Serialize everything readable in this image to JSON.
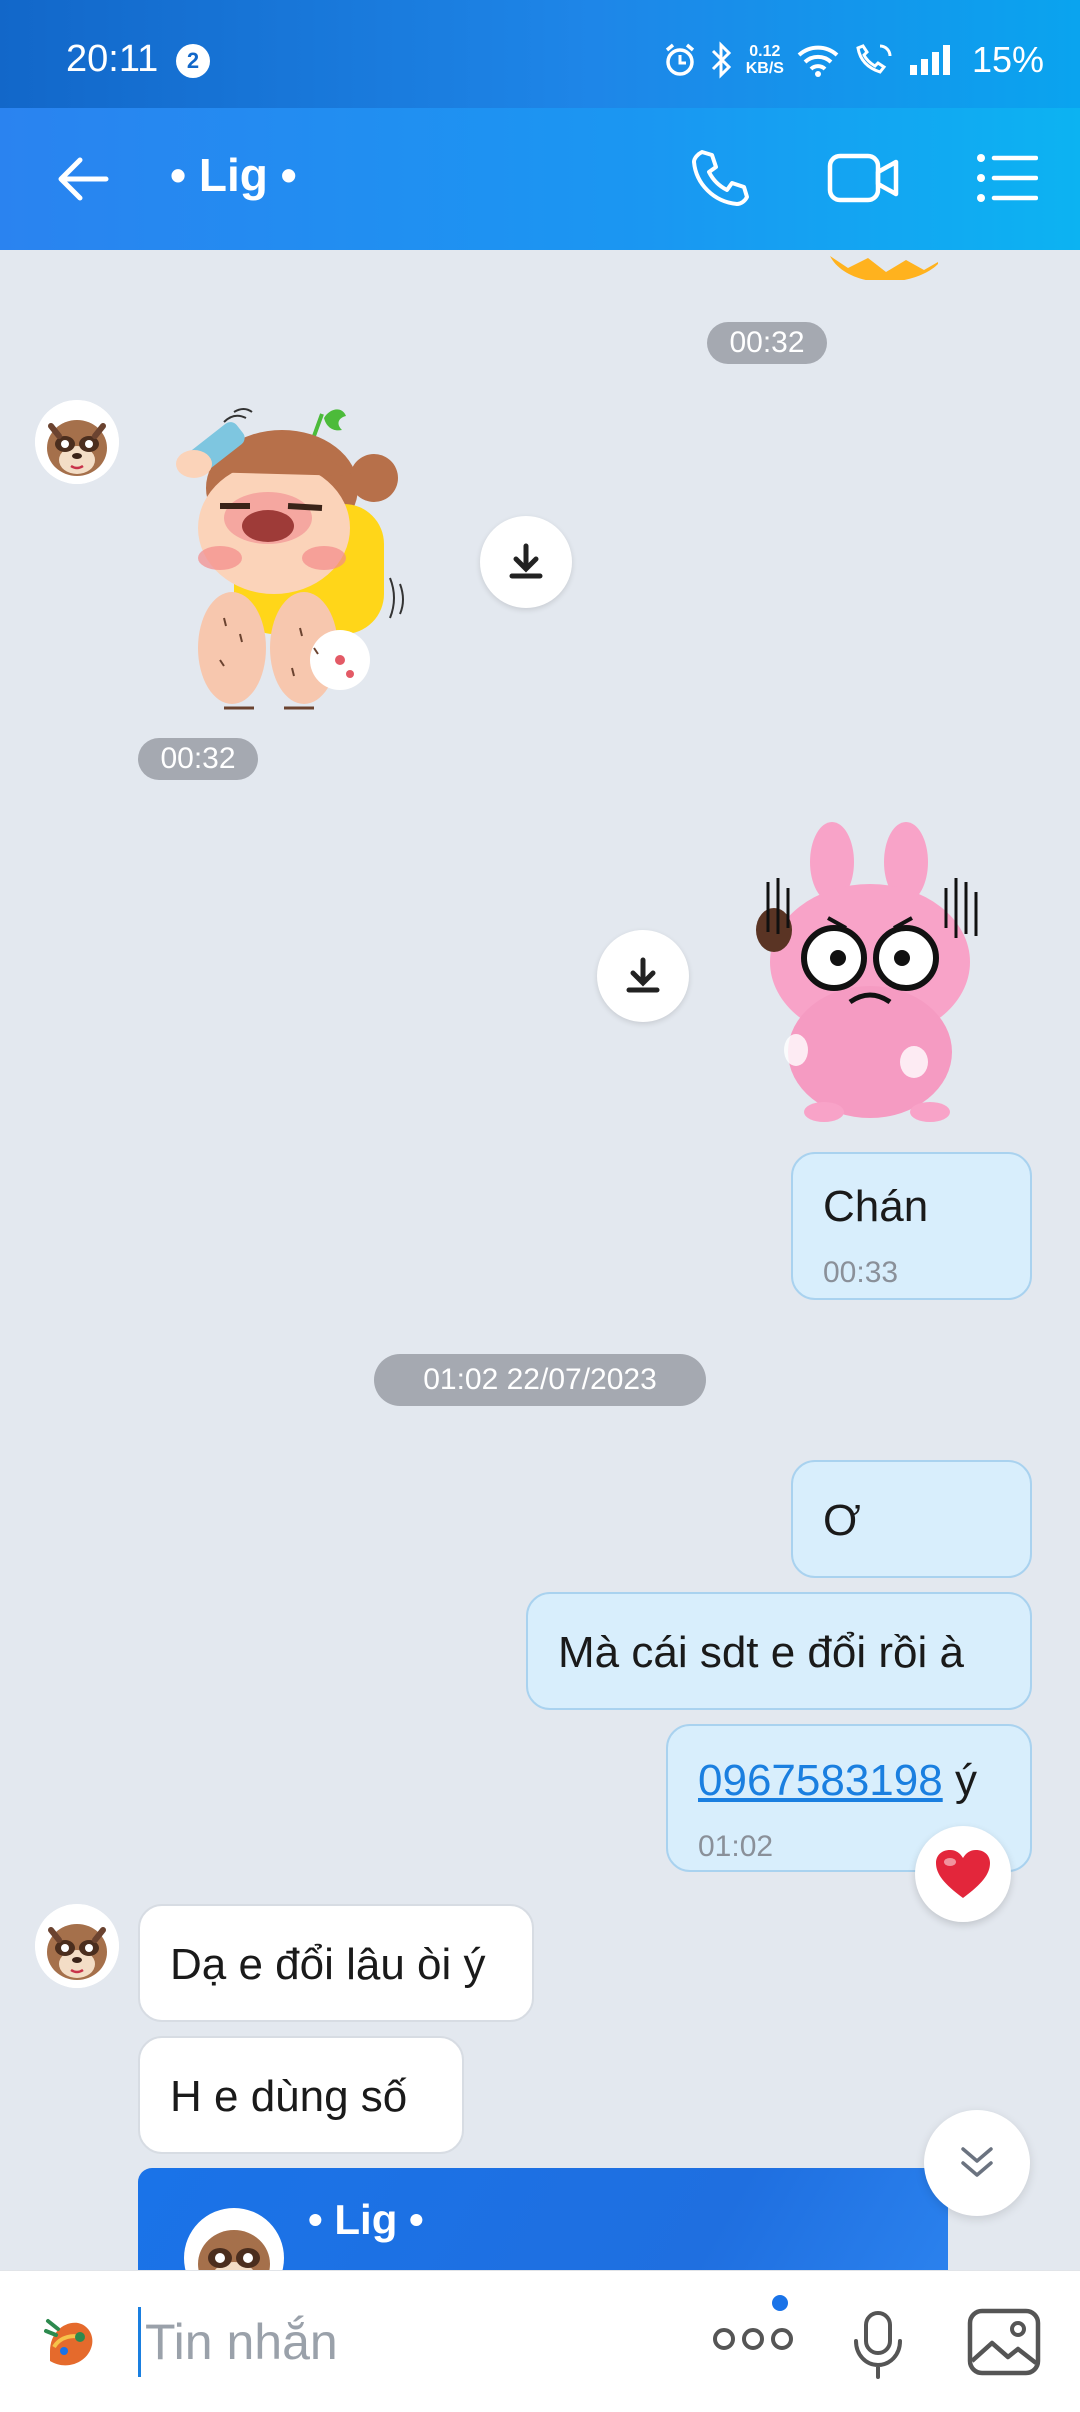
{
  "status_bar": {
    "time": "20:11",
    "notification_count": "2",
    "net_speed_value": "0.12",
    "net_speed_unit": "KB/S",
    "battery": "15%"
  },
  "header": {
    "title": "• Lig •"
  },
  "messages": {
    "time_sticker_sent": "00:32",
    "time_sticker_received": "00:32",
    "chan_text": "Chán",
    "chan_time": "00:33",
    "date_separator": "01:02 22/07/2023",
    "o_text": "Ơ",
    "ma_cai_text": "Mà cái sdt e đổi rồi à",
    "phone_number": "0967583198",
    "phone_suffix": " ý",
    "phone_time": "01:02",
    "reply1": "Dạ e đổi lâu òi ý",
    "reply2": "H e dùng số",
    "contact_card_name": "• Lig •"
  },
  "input_bar": {
    "placeholder": "Tin nhắn"
  },
  "colors": {
    "header_start": "#2a83f0",
    "header_end": "#0cb3f2",
    "my_bubble": "#d8eefc",
    "their_bubble": "#ffffff",
    "background": "#e3e8ef",
    "accent": "#1a73e8"
  },
  "icons": {
    "back": "arrow-left-icon",
    "call": "phone-icon",
    "video": "video-camera-icon",
    "menu": "list-menu-icon",
    "download": "download-icon",
    "heart": "heart-icon",
    "scroll": "chevron-double-down-icon",
    "emoji": "sticker-icon",
    "more": "more-dots-icon",
    "mic": "microphone-icon",
    "image": "image-icon"
  }
}
